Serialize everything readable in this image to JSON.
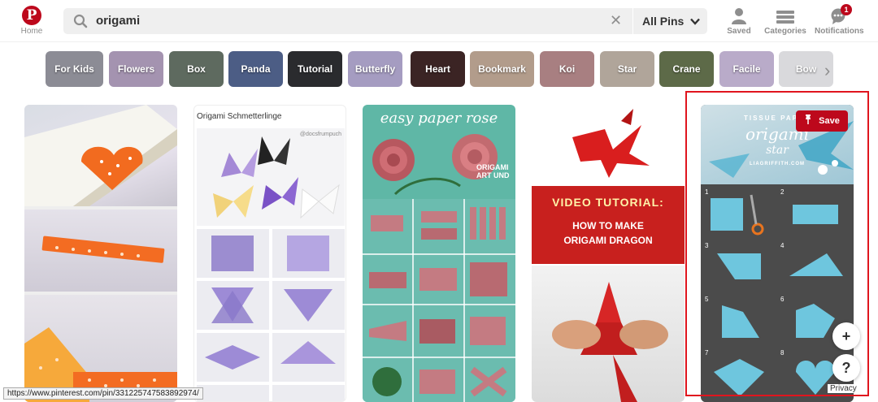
{
  "header": {
    "home_label": "Home",
    "search_value": "origami",
    "scope_label": "All Pins",
    "nav": {
      "saved_label": "Saved",
      "categories_label": "Categories",
      "notifications_label": "Notifications",
      "notifications_count": "1"
    }
  },
  "guides": [
    {
      "label": "For Kids",
      "color": "#8c8c95"
    },
    {
      "label": "Flowers",
      "color": "#a493b0"
    },
    {
      "label": "Box",
      "color": "#5e6a5f"
    },
    {
      "label": "Panda",
      "color": "#4c5d85"
    },
    {
      "label": "Tutorial",
      "color": "#2a2b2e"
    },
    {
      "label": "Butterfly",
      "color": "#a59cc1"
    },
    {
      "label": "Heart",
      "color": "#3b2424"
    },
    {
      "label": "Bookmark",
      "color": "#b29c8b"
    },
    {
      "label": "Koi",
      "color": "#a87f81"
    },
    {
      "label": "Star",
      "color": "#b0a59a"
    },
    {
      "label": "Crane",
      "color": "#5d6a48"
    },
    {
      "label": "Facile",
      "color": "#b9abc9"
    },
    {
      "label": "Bow",
      "color": "#d9d9dc"
    }
  ],
  "pins": {
    "butterfly_title": "Origami Schmetterlinge",
    "butterfly_watermark": "@docsfrumpuch",
    "rose_caption": "easy paper rose",
    "rose_brand": "ORIGAMI ART UND",
    "dragon_caption_line1": "VIDEO TUTORIAL:",
    "dragon_caption_line2": "HOW TO MAKE",
    "dragon_caption_line3": "ORIGAMI DRAGON",
    "star_caption_top": "TISSUE PAPER",
    "star_caption_mid": "origami",
    "star_caption_bottom": "star",
    "star_caption_url": "LIAGRIFFITH.COM",
    "star_steps": [
      "1",
      "2",
      "3",
      "4",
      "5",
      "6",
      "7",
      "8"
    ]
  },
  "actions": {
    "save_label": "Save",
    "add_label": "+",
    "help_label": "?",
    "privacy_label": "Privacy"
  },
  "status_url": "https://www.pinterest.com/pin/331225747583892974/",
  "colors": {
    "brand_red": "#bd081c",
    "highlight_red": "#e0151e",
    "search_bg": "#efefef"
  }
}
